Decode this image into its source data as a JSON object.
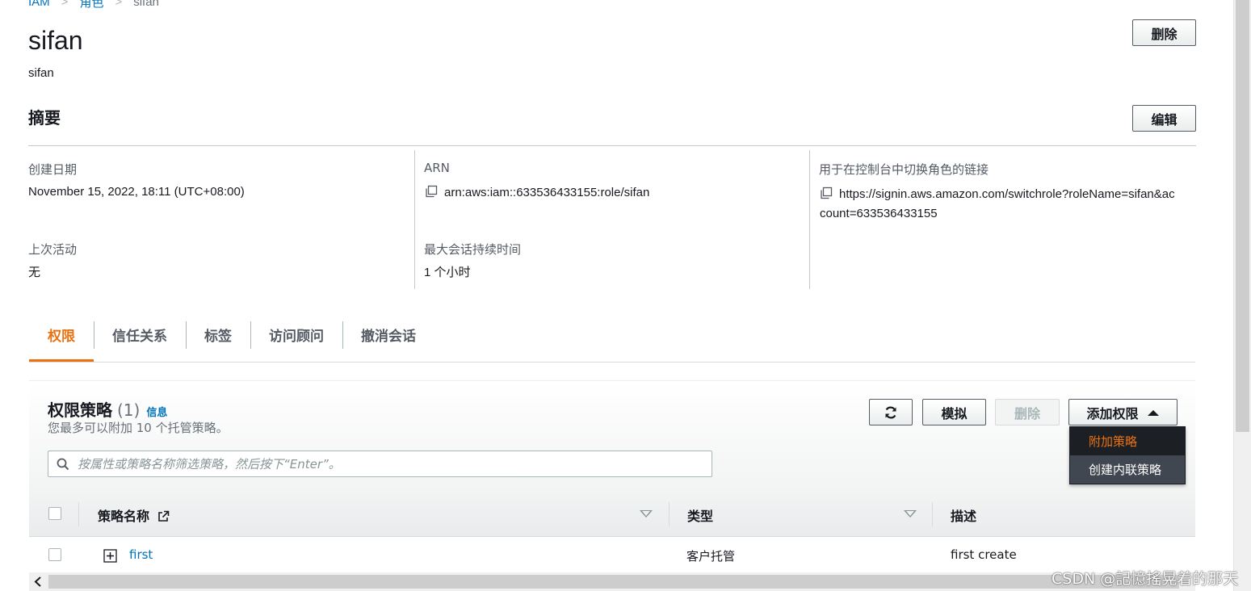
{
  "breadcrumb": [
    "IAM",
    "角色",
    "sifan"
  ],
  "page": {
    "title": "sifan",
    "subtitle": "sifan",
    "delete_label": "删除"
  },
  "summary": {
    "title": "摘要",
    "edit_label": "编辑",
    "created_label": "创建日期",
    "created_value": "November 15, 2022, 18:11 (UTC+08:00)",
    "arn_label": "ARN",
    "arn_value": "arn:aws:iam::633536433155:role/sifan",
    "switch_label": "用于在控制台中切换角色的链接",
    "switch_value_line1": "https://signin.aws.amazon.com/switchrole?roleName=sifan&ac",
    "switch_value_line2": "count=633536433155",
    "last_activity_label": "上次活动",
    "last_activity_value": "无",
    "max_session_label": "最大会话持续时间",
    "max_session_value": "1 个小时"
  },
  "tabs": [
    {
      "label": "权限",
      "active": true
    },
    {
      "label": "信任关系"
    },
    {
      "label": "标签"
    },
    {
      "label": "访问顾问"
    },
    {
      "label": "撤消会话"
    }
  ],
  "policies": {
    "title": "权限策略",
    "count": "(1)",
    "info": "信息",
    "subtitle": "您最多可以附加 10 个托管策略。",
    "refresh_icon": "refresh-icon",
    "simulate_label": "模拟",
    "delete_label": "删除",
    "add_label": "添加权限",
    "search_placeholder": "按属性或策略名称筛选策略，然后按下“Enter”。",
    "dropdown": [
      "附加策略",
      "创建内联策略"
    ],
    "columns": {
      "name": "策略名称",
      "type": "类型",
      "desc": "描述"
    },
    "rows": [
      {
        "name": "first",
        "type": "客户托管",
        "desc": "first create"
      }
    ]
  },
  "watermark": "CSDN @記憶搖晃着的那天",
  "colors": {
    "accent": "#ec7211",
    "link": "#0073bb",
    "text": "#16191f"
  }
}
